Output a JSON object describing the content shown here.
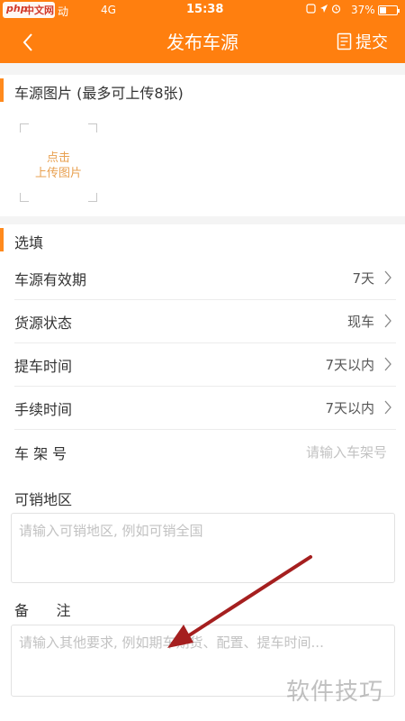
{
  "status_bar": {
    "logo_php": "php",
    "logo_cn": "中文网",
    "carrier": "动",
    "network": "4G",
    "time": "15:38",
    "battery_text": "37%",
    "battery_level": 0.37
  },
  "nav": {
    "title": "发布车源",
    "submit_label": "提交"
  },
  "photos": {
    "header": "车源图片 (最多可上传8张)",
    "upload_line1": "点击",
    "upload_line2": "上传图片"
  },
  "optional": {
    "header": "选填",
    "rows": [
      {
        "label": "车源有效期",
        "value": "7天"
      },
      {
        "label": "货源状态",
        "value": "现车"
      },
      {
        "label": "提车时间",
        "value": "7天以内"
      },
      {
        "label": "手续时间",
        "value": "7天以内"
      }
    ],
    "vin": {
      "label": "车 架 号",
      "placeholder": "请输入车架号"
    },
    "sale_area": {
      "label": "可销地区",
      "placeholder": "请输入可销地区, 例如可销全国"
    },
    "remarks": {
      "label": "备      注",
      "placeholder": "请输入其他要求, 例如期车期货、配置、提车时间..."
    }
  },
  "watermark": "软件技巧",
  "colors": {
    "accent": "#ff7f0f",
    "section_accent": "#ff8a1d",
    "arrow": "#a51f1f"
  },
  "icons": [
    "back-arrow-icon",
    "document-icon",
    "chevron-right-icon",
    "alarm-icon",
    "battery-icon"
  ]
}
